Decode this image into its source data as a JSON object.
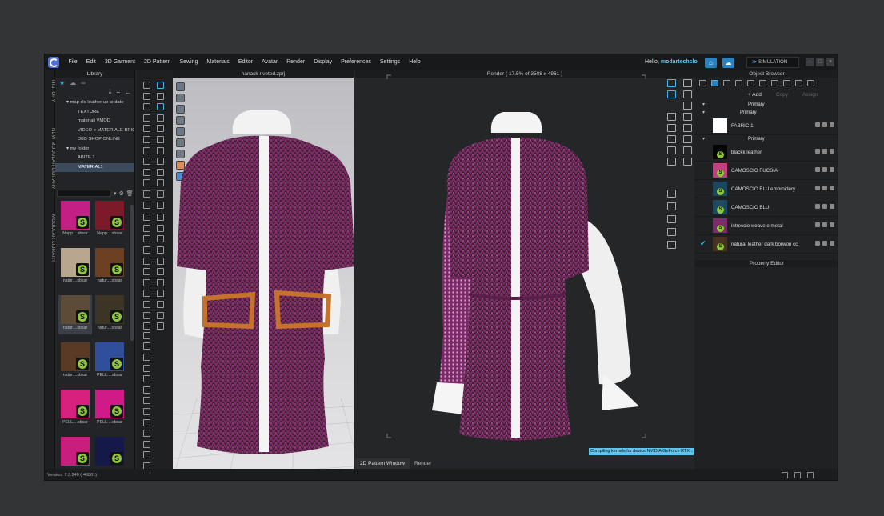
{
  "menubar": {
    "items": [
      "File",
      "Edit",
      "3D Garment",
      "2D Pattern",
      "Sewing",
      "Materials",
      "Editor",
      "Avatar",
      "Render",
      "Display",
      "Preferences",
      "Settings",
      "Help"
    ],
    "hello": "Hello, ",
    "user": "modartechclo",
    "mode": "SIMULATION"
  },
  "side_tabs": [
    "HISTORY",
    "NEW MODULAR LIBRARY",
    "MODULAR LIBRARY"
  ],
  "library": {
    "title": "Library",
    "tree": [
      "▾  map clo leather up to date",
      "TEXTURE",
      "materiali VMOD",
      "VIDEO e MATERIALE BRIGHT",
      "DEB SHOP ONLINE",
      "▾  my folder",
      "ABITE.1",
      "MATERIAL1"
    ],
    "tiles": [
      {
        "label": "Napp....sbsar",
        "color": "#c41f83"
      },
      {
        "label": "Napp....sbsar",
        "color": "#7c1a2a"
      },
      {
        "label": "natur....sbsar",
        "color": "#b9a68f"
      },
      {
        "label": "natur....sbsar",
        "color": "#6d4023"
      },
      {
        "label": "natur....sbsar",
        "color": "#5c4b37"
      },
      {
        "label": "natur....sbsar",
        "color": "#3c3526"
      },
      {
        "label": "natur....sbsar",
        "color": "#5b3a25"
      },
      {
        "label": "PELL....sbsar",
        "color": "#2f4f9a"
      },
      {
        "label": "PELL....sbsar",
        "color": "#d8207f"
      },
      {
        "label": "PELL....sbsar",
        "color": "#d01a88"
      },
      {
        "label": "",
        "color": "#c81f7f"
      },
      {
        "label": "",
        "color": "#14194a"
      }
    ]
  },
  "viewport3d": {
    "title": "hanack riveted.zprj"
  },
  "render": {
    "title": "Render ( 17.5% of 3508 x 4961 )",
    "status": "Compiling kernels for device NVIDIA GeForce RTX..."
  },
  "bottom_tabs": [
    "2D Pattern Window",
    "Render"
  ],
  "object_browser": {
    "title": "Object Browser",
    "add": "+ Add",
    "copy": "Copy",
    "assign": "Assign",
    "primary_label": "Primary",
    "fabrics": [
      {
        "name": "FABRIC 1",
        "color": "#ffffff",
        "badge": false,
        "check": false
      },
      {
        "name": "blackk leather",
        "color": "#050505",
        "badge": true,
        "check": false
      },
      {
        "name": "CAMOSCIO FUCSIA",
        "color": "#c2407f",
        "badge": true,
        "check": false
      },
      {
        "name": "CAMOSCIO BLU embroidery",
        "color": "#17485f",
        "badge": true,
        "check": false
      },
      {
        "name": "CAMOSCIO BLU",
        "color": "#1b4a63",
        "badge": true,
        "check": false
      },
      {
        "name": "intreccio weave e metal",
        "color": "#7a2d6a",
        "badge": true,
        "check": false
      },
      {
        "name": "natural leather dark borwon cc",
        "color": "#4a3322",
        "badge": true,
        "check": true
      }
    ]
  },
  "property_editor": {
    "title": "Property Editor"
  },
  "version": "Version: 7.3.240 (r46861)",
  "colors": {
    "accent": "#5ec5ee",
    "fabric": "#8a2e6e",
    "substance": "#8ec63f"
  }
}
